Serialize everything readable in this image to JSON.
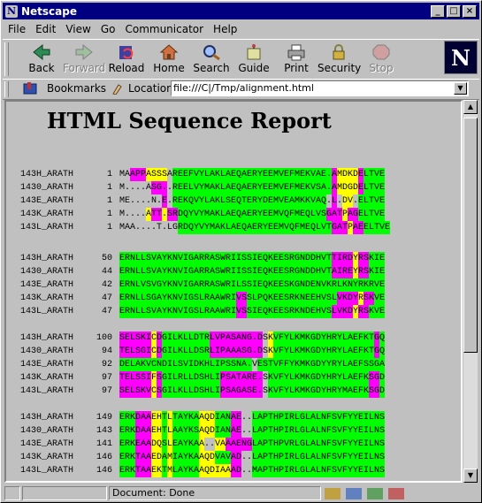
{
  "window": {
    "title": "Netscape"
  },
  "menu": [
    "File",
    "Edit",
    "View",
    "Go",
    "Communicator",
    "Help"
  ],
  "toolbar": [
    {
      "label": "Back",
      "icon": "back-arrow-icon",
      "enabled": true
    },
    {
      "label": "Forward",
      "icon": "forward-arrow-icon",
      "enabled": false
    },
    {
      "label": "Reload",
      "icon": "reload-icon",
      "enabled": true
    },
    {
      "label": "Home",
      "icon": "home-icon",
      "enabled": true
    },
    {
      "label": "Search",
      "icon": "search-icon",
      "enabled": true
    },
    {
      "label": "Guide",
      "icon": "guide-icon",
      "enabled": true
    },
    {
      "label": "Print",
      "icon": "print-icon",
      "enabled": true
    },
    {
      "label": "Security",
      "icon": "lock-icon",
      "enabled": true
    },
    {
      "label": "Stop",
      "icon": "stop-icon",
      "enabled": false
    }
  ],
  "location_bar": {
    "bookmarks_label": "Bookmarks",
    "location_label": "Location:",
    "url": "file:///C|/Tmp/alignment.html"
  },
  "report": {
    "title": "HTML Sequence Report",
    "colors": {
      "green": "#00ff00",
      "magenta": "#ff00ff",
      "yellow": "#ffff00",
      "none": "transparent"
    },
    "color_key": {
      "G": "green",
      "M": "magenta",
      "Y": "yellow",
      ".": "none"
    },
    "blocks": [
      {
        "rows": [
          {
            "name": "143H_ARATH",
            "start": "1",
            "seq": "MAAPPASSSAREEFVYLAKLAEQAERYEEMVEFMEKVAE.AMDKDELTVE",
            "cols": "..MMMYYYY.GGGGGGGGGGGGGGGGGGGGGGGGGGGGGGMYYYYMGGGGG"
          },
          {
            "name": "1430_ARATH",
            "start": "1",
            "seq": "M....ASG..REELVYMAKLAEQAERYEEMVEFMEKVSA.AMDGDELTVE",
            "cols": "......MMM.GGGGGGGGGGGGGGGGGGGGGGGGGGGGGGMYYYYMGGGGG"
          },
          {
            "name": "143E_ARATH",
            "start": "1",
            "seq": "ME....N.E.REKQVYLAKLSEQTERYDEMVEAMKKVAQ.L.DV.ELTVE",
            "cols": "........M.GGGGGGGGGGGGGGGGGGGGGGGGGGGGG.M.YY.GGGGG"
          },
          {
            "name": "143K_ARATH",
            "start": "1",
            "seq": "M....ATT.SRDQYVYMAKLAEQAERYEEMVQFMEQLVSGATPAGELTVE",
            "cols": ".....YMMYMMGGGGGGGGGGGGGGGGGGGGGGGGGGGGMMMYMMGGGGG"
          },
          {
            "name": "143L_ARATH",
            "start": "1",
            "seq": "MAA....T.LGRDQYVYMAKLAEQAERYEEMVQFMEQLVTGATPAEELTVE",
            "cols": "...........GGGGGGGGGGGGGGGGGGGGGGGGGGGGGMMMYMMGGGGG"
          }
        ]
      },
      {
        "rows": [
          {
            "name": "143H_ARATH",
            "start": "50",
            "seq": "ERNLLSVAYKNVIGARRASWRIISSIEQKEESRGNDDHVTTIRDYRSKIE",
            "cols": "GGGGGGGGGGGGGGGGGGGGGGGGGGGGGGGGGGGGGGGGMMMMYMMGGGG"
          },
          {
            "name": "1430_ARATH",
            "start": "44",
            "seq": "ERNLLSVAYKNVIGARRASWRIISSIEQKEESRGNDDHVTAIREYRSKIE",
            "cols": "GGGGGGGGGGGGGGGGGGGGGGGGGGGGGGGGGGGGGGGGMMMMYMMGGGG"
          },
          {
            "name": "143E_ARATH",
            "start": "42",
            "seq": "ERNLVSVGYKNVIGARRASWRILSSIEQKEESKGNDENVKRLKNYRKRVE",
            "cols": "GGGGGGGGGGGGGGGGGGGGGGGGGGGGGGGGGGGGGGGGGGGGGGGGGG"
          },
          {
            "name": "143K_ARATH",
            "start": "47",
            "seq": "ERNLLSGAYKNVIGSLRAAWRIVSSLPQKEESRKNEEHVSLVKDYRSKVE",
            "cols": "GGGGGGGGGGGGGGGGGGGGGGMMGGGGGGGGGGGGGGGGGMMMMYMMGGG"
          },
          {
            "name": "143L_ARATH",
            "start": "47",
            "seq": "ERNLLSVAYKNVIGSLRAAWRIVSSIEQKEESRKNDEHVSLVKDYRSKVE",
            "cols": "GGGGGGGGGGGGGGGGGGGGGGMMGGGGGGGGGGGGGGGGMMMMYMMGGGG"
          }
        ]
      },
      {
        "rows": [
          {
            "name": "143H_ARATH",
            "start": "100",
            "seq": "SELSKICDGILKLLDTRLVPASANG.DSKVFYLKMKGDYHRYLAEFKTGQ",
            "cols": "MMMMMMYMGGGGGGGGGMMMMMMMMMM.YGGGGGGGGGGGGGGGGGGGMGG"
          },
          {
            "name": "1430_ARATH",
            "start": "94",
            "seq": "TELSGICDGILKLLDSRLIPAAASG.DSKVFYLKMKGDYHRYLAEFKTGQ",
            "cols": "MMMMMMYMGGGGGGGGGMMMMMMMMMM.YGGGGGGGGGGGGGGGGGGGMGG"
          },
          {
            "name": "143E_ARATH",
            "start": "92",
            "seq": "DELAKVCNDILSVIDKHLIPSSNA.VESTVFFYKMKGDYYRYLAEFSSGA",
            "cols": "GGGGGGGGGGGGGGGGGGGGGGGGG.GGGGGGGGGGGGGGGGGGGGGGGG"
          },
          {
            "name": "143K_ARATH",
            "start": "97",
            "seq": "TELSSIFSGILRLLDSHLIPSATARE.SKVFYLKMKGDYHRYLAEFKSGD",
            "cols": "MMMMMMYMGGGGGGGGGGGMMMMMMMM.GGGGGGGGGGGGGGGGGGGMMGG"
          },
          {
            "name": "143L_ARATH",
            "start": "97",
            "seq": "SELSKVCSGILKLLDSHLIPSAGASE.SKVFYLKMKGDYHRYMAEFKSGD",
            "cols": "MMMMMMYMGGGGGGGGGGGMMMMMMMM.GGGGGGGGGGGGGGGGGGGMMGG"
          }
        ]
      },
      {
        "rows": [
          {
            "name": "143H_ARATH",
            "start": "149",
            "seq": "ERKDAAEHTLTAYKAAQDIANAE..LAPTHPIRLGLALNFSVFYYEILNS",
            "cols": "GGGMMMYYGYGGGGGYYYGGGMM..GGGGGGGGGGGGGGGGGGGGGGGGGG"
          },
          {
            "name": "1430_ARATH",
            "start": "143",
            "seq": "ERKDAAEHTLAAYKSAQDIANAE..LAPTHPIRLGLALNFSVFYYEILNS",
            "cols": "GGGMMMYYGYGGGGGYYYGGGMM..GGGGGGGGGGGGGGGGGGGGGGGGGG"
          },
          {
            "name": "143E_ARATH",
            "start": "141",
            "seq": "ERKEAADQSLEAYKAA..VAAAENGLAPTHPVRLGLALNFSVFYYEILNS",
            "cols": "GGGMMMYYGYGGGGGY..YYMMMMMGGGGGGGGGGGGGGGGGGGGGGGGG"
          },
          {
            "name": "143K_ARATH",
            "start": "146",
            "seq": "ERKTAAEDAMIAYKAAQDVAVAD..LAPTHPIRLGLALNFSVFYYEILNS",
            "cols": "GGGMMMYYGYGGGGGYYYGGGMM..GGGGGGGGGGGGGGGGGGGGGGGGGG"
          },
          {
            "name": "143L_ARATH",
            "start": "146",
            "seq": "ERKTAAEKTMLAYKAAQDIAAAD..MAPTHPIRLGLALNFSVFYYEILNS",
            "cols": "GGGMMMYYGYGGGGGYYYYYYMM..GGGGGGGGGGGGGGGGGGGGGGGGGG"
          }
        ]
      }
    ]
  },
  "status": {
    "text": "Document: Done"
  }
}
